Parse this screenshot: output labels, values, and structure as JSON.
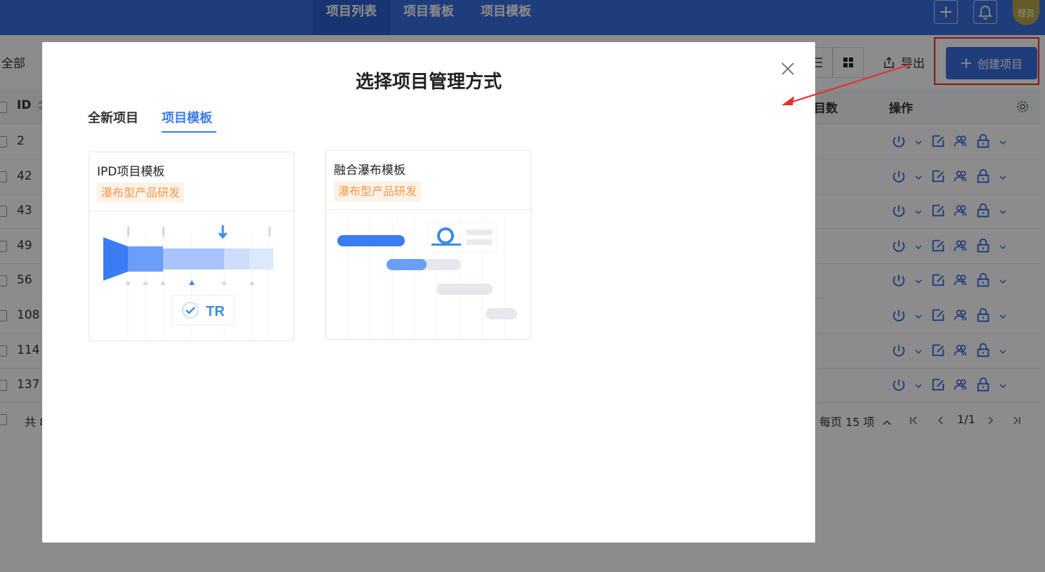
{
  "nav": {
    "tabs": [
      {
        "label": "项目列表"
      },
      {
        "label": "项目看板"
      },
      {
        "label": "项目模板"
      }
    ],
    "avatar_text": "理员"
  },
  "toolbar": {
    "filter_all": "全部",
    "export_label": "导出",
    "create_label": "创建项目"
  },
  "table": {
    "col_id": "ID",
    "col_count_partial": "目数",
    "col_actions": "操作",
    "rows": [
      {
        "id": "2"
      },
      {
        "id": "42"
      },
      {
        "id": "43"
      },
      {
        "id": "49"
      },
      {
        "id": "56"
      },
      {
        "id": "108"
      },
      {
        "id": "114"
      },
      {
        "id": "137"
      }
    ],
    "total_partial": "共 8",
    "page_size": "每页 15 项",
    "page_indicator": "1/1"
  },
  "modal": {
    "title": "选择项目管理方式",
    "tabs": [
      {
        "label": "全新项目",
        "active": false
      },
      {
        "label": "项目模板",
        "active": true
      }
    ],
    "cards": [
      {
        "name": "IPD项目模板",
        "tag": "瀑布型产品研发",
        "illustration": "ipd-funnel",
        "badge": "TR"
      },
      {
        "name": "融合瀑布模板",
        "tag": "瀑布型产品研发",
        "illustration": "gantt"
      }
    ]
  },
  "colors": {
    "primary": "#3a6fe0",
    "tab_active": "#3a7bea",
    "tag_text": "#f29a4a",
    "tag_bg": "#fdf2e8",
    "annotation_red": "#e8312a"
  }
}
